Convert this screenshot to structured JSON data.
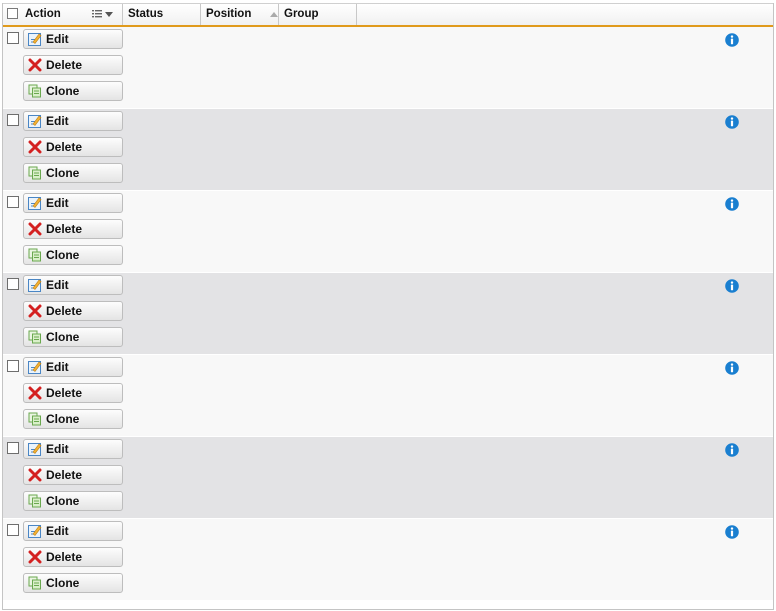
{
  "columns": {
    "action": "Action",
    "status": "Status",
    "position": "Position",
    "group": "Group"
  },
  "buttons": {
    "edit": "Edit",
    "delete": "Delete",
    "clone": "Clone"
  },
  "row_count": 7,
  "icons": {
    "info": "info-icon",
    "edit": "edit-icon",
    "delete": "delete-icon",
    "clone": "clone-icon"
  },
  "colors": {
    "header_accent": "#e09a1c",
    "info_blue": "#1a7fd0",
    "delete_red": "#d42020",
    "clone_green": "#6aa84f"
  }
}
